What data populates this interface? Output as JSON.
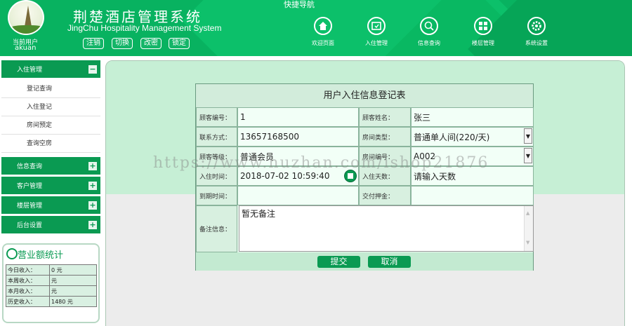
{
  "header": {
    "title": "荆楚酒店管理系统",
    "subtitle": "JingChu Hospitality Management System",
    "user_label": "当前用户",
    "user_name": "akuan",
    "account_buttons": [
      "注销",
      "切换",
      "改密",
      "锁定"
    ],
    "quick_nav_title": "快捷导航",
    "nav": [
      {
        "label": "欢迎页面",
        "icon": "home-icon"
      },
      {
        "label": "入住管理",
        "icon": "checkin-icon"
      },
      {
        "label": "信息查询",
        "icon": "search-icon"
      },
      {
        "label": "楼层管理",
        "icon": "grid-icon"
      },
      {
        "label": "系统设置",
        "icon": "gear-icon"
      }
    ]
  },
  "sidebar": {
    "sections": [
      {
        "label": "入住管理",
        "toggle": "−",
        "items": [
          "登记查询",
          "入住登记",
          "房间预定",
          "查询空房"
        ]
      },
      {
        "label": "信息查询",
        "toggle": "+"
      },
      {
        "label": "客户管理",
        "toggle": "+"
      },
      {
        "label": "楼层管理",
        "toggle": "+"
      },
      {
        "label": "后台设置",
        "toggle": "+"
      }
    ],
    "stats": {
      "title": "营业额统计",
      "rows": [
        {
          "label": "今日收入：",
          "value": "0 元"
        },
        {
          "label": "本周收入：",
          "value": "元"
        },
        {
          "label": "本月收入：",
          "value": "元"
        },
        {
          "label": "历史收入：",
          "value": "1480 元"
        }
      ]
    }
  },
  "form": {
    "title": "用户入住信息登记表",
    "fields": {
      "customer_no_label": "顾客编号：",
      "customer_no": "1",
      "customer_name_label": "顾客姓名：",
      "customer_name": "张三",
      "contact_label": "联系方式：",
      "contact": "13657168500",
      "room_type_label": "房间类型：",
      "room_type": "普通单人间(220/天)",
      "level_label": "顾客等级：",
      "level": "普通会员",
      "room_no_label": "房间编号：",
      "room_no": "A002",
      "checkin_time_label": "入住时间：",
      "checkin_time": "2018-07-02 10:59:40",
      "days_label": "入住天数：",
      "days_placeholder": "请输入天数",
      "due_label": "到期时间：",
      "due": "",
      "deposit_label": "交付押金：",
      "deposit": "",
      "remark_label": "备注信息：",
      "remark": "暂无备注"
    },
    "submit_label": "提交",
    "cancel_label": "取消"
  },
  "watermark": "https://www.huzhan.com/ishop21876",
  "colors": {
    "primary": "#08b260",
    "dark_green": "#0a9a52",
    "band": "#c6efd5"
  }
}
